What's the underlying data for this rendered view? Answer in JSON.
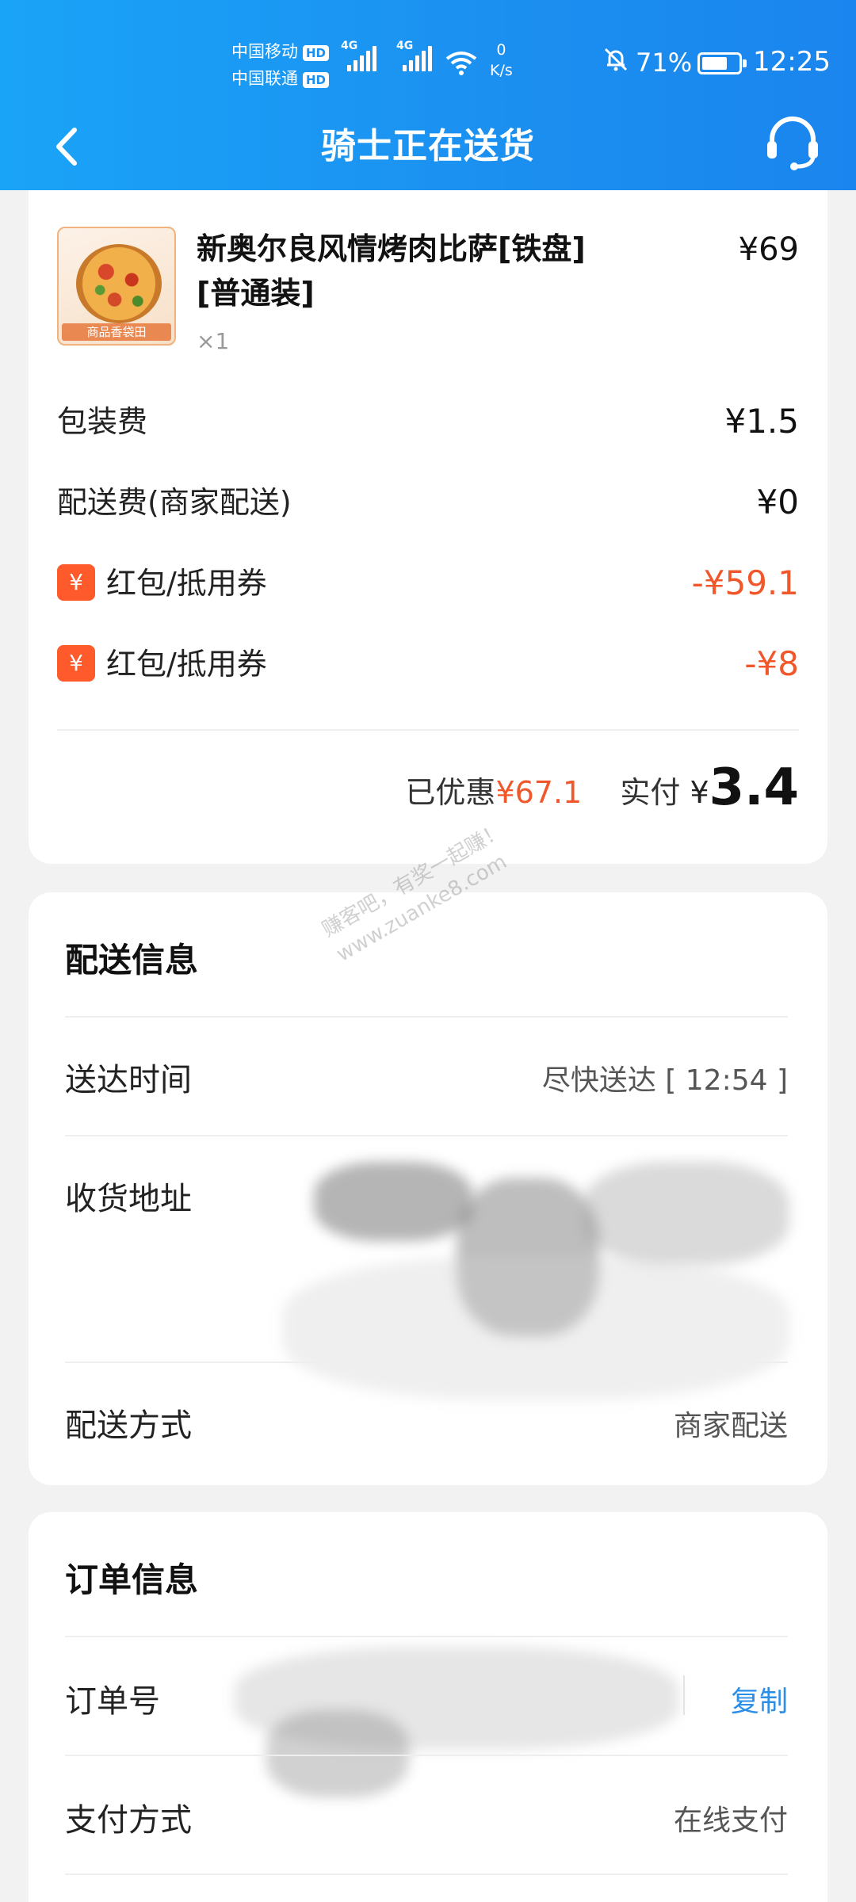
{
  "status_bar": {
    "carrier1": "中国移动",
    "carrier2": "中国联通",
    "hd": "HD",
    "network1": "4G",
    "network2": "4G",
    "speed_value": "0",
    "speed_unit": "K/s",
    "battery": "71%",
    "battery_level": 0.71,
    "time": "12:25"
  },
  "header": {
    "title": "骑士正在送货",
    "back_icon": "chevron-left-icon",
    "support_icon": "headset-icon"
  },
  "order_item": {
    "name": "新奥尔良风情烤肉比萨[铁盘][普通装]",
    "quantity": "×1",
    "price": "¥69",
    "thumb_badge": "商品香袋田"
  },
  "fees": [
    {
      "label": "包装费",
      "value": "¥1.5"
    },
    {
      "label": "配送费(商家配送)",
      "value": "¥0"
    },
    {
      "label": "红包/抵用券",
      "value": "-¥59.1",
      "icon": "¥"
    },
    {
      "label": "红包/抵用券",
      "value": "-¥8",
      "icon": "¥"
    }
  ],
  "totals": {
    "discount_label": "已优惠",
    "discount_value": "¥67.1",
    "paid_label": "实付",
    "paid_currency": "¥",
    "paid_value": "3.4"
  },
  "delivery_info": {
    "title": "配送信息",
    "time_label": "送达时间",
    "time_value": "尽快送达 [ 12:54 ]",
    "address_label": "收货地址",
    "method_label": "配送方式",
    "method_value": "商家配送"
  },
  "order_info": {
    "title": "订单信息",
    "order_no_label": "订单号",
    "copy_label": "复制",
    "payment_label": "支付方式",
    "payment_value": "在线支付"
  },
  "watermark": {
    "line1": "赚客吧，有奖一起赚！",
    "line2": "www.zuanke8.com"
  },
  "colors": {
    "header_blue": "#1a8ff0",
    "accent_red": "#f0572a",
    "link_blue": "#2b8ee8",
    "coupon_orange": "#ff5a2b"
  }
}
